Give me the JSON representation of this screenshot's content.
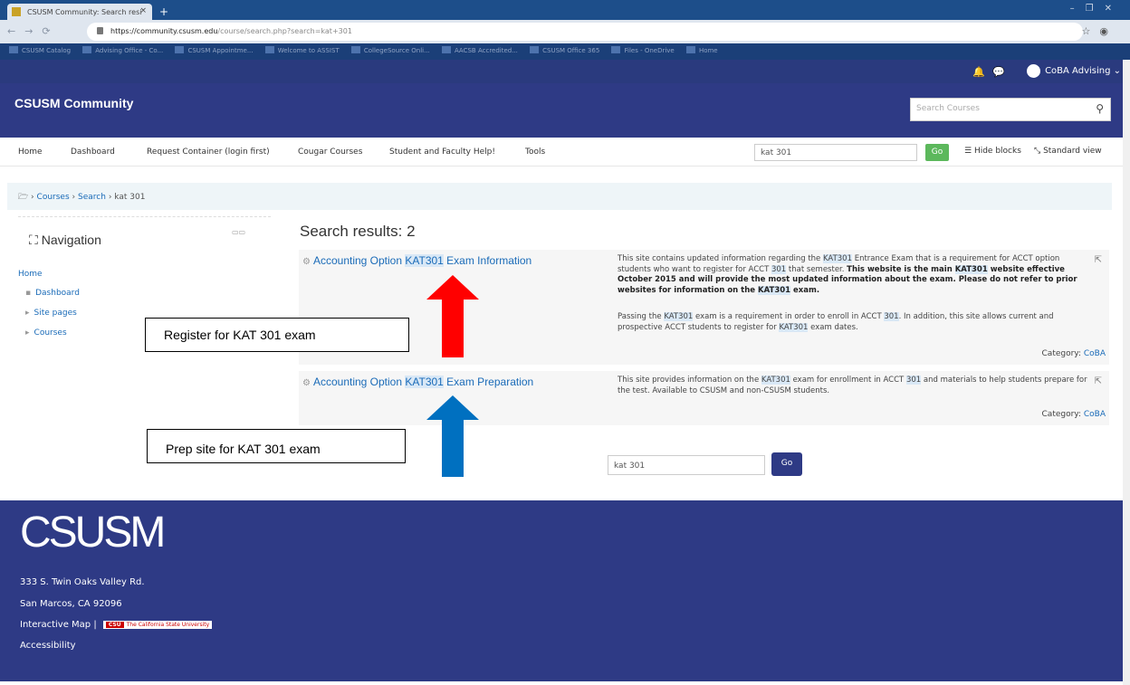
{
  "browser": {
    "tab_title": "CSUSM Community: Search resi",
    "tab_close": "×",
    "new_tab": "+",
    "url_host": "https://community.csusm.edu",
    "url_path": "/course/search.php?search=kat+301",
    "bookmarks": [
      "CSUSM Catalog",
      "Advising Office - Co...",
      "CSUSM Appointme...",
      "Welcome to ASSIST",
      "CollegeSource Onli...",
      "AACSB Accredited...",
      "CSUSM Office 365",
      "Files - OneDrive",
      "Home"
    ]
  },
  "topbar": {
    "user_name": "CoBA Advising ⌄"
  },
  "header": {
    "site_title": "CSUSM Community",
    "search_placeholder": "Search Courses"
  },
  "menu": {
    "items": [
      "Home",
      "Dashboard",
      "Request Container (login first)",
      "Cougar Courses",
      "Student and Faculty Help!",
      "Tools"
    ],
    "search_value": "kat 301",
    "go_label": "Go",
    "hide_blocks": "Hide blocks",
    "standard_view": "Standard view"
  },
  "breadcrumb": {
    "courses": "Courses",
    "search": "Search",
    "current": "kat 301",
    "sep": "›"
  },
  "navigation": {
    "title": "Navigation",
    "home": "Home",
    "items": [
      "Dashboard",
      "Site pages",
      "Courses"
    ]
  },
  "results": {
    "heading": "Search results: 2",
    "items": [
      {
        "name_pre": "Accounting Option ",
        "name_hl": "KAT301",
        "name_post": " Exam Information",
        "summary_html_1": "This site contains updated information regarding the <span class=\"hl\">KAT301</span> Entrance Exam that is a requirement for ACCT option students who want to register for ACCT <span class=\"hl\">301</span> that semester. <span class=\"bold\">This website is the main <span class=\"hl\">KAT301</span> website effective October 2015 and will provide the most updated information about the exam. Please do not refer to prior websites for information on the <span class=\"hl\">KAT301</span> exam.</span>",
        "summary_html_2": "Passing the <span class=\"hl\">KAT301</span> exam is a requirement in order to enroll in ACCT <span class=\"hl\">301</span>. In addition, this site allows current and prospective ACCT students to register for <span class=\"hl\">KAT301</span> exam dates.",
        "category_label": "Category: ",
        "category": "CoBA"
      },
      {
        "name_pre": "Accounting Option ",
        "name_hl": "KAT301",
        "name_post": " Exam Preparation",
        "summary_html_1": "This site provides information on the <span class=\"hl\">KAT301</span> exam for enrollment in ACCT <span class=\"hl\">301</span> and materials to help students prepare for the test.  Available to CSUSM and non-CSUSM students.",
        "category_label": "Category: ",
        "category": "CoBA"
      }
    ],
    "bottom_search_value": "kat 301",
    "bottom_go": "Go"
  },
  "callouts": {
    "register": "Register for KAT 301 exam",
    "prep": "Prep site for KAT 301 exam",
    "red_arrow_color": "#ff0000",
    "blue_arrow_color": "#0070c0"
  },
  "footer": {
    "logo": "CSUSM",
    "address1": "333 S. Twin Oaks Valley Rd.",
    "address2": "San Marcos, CA 92096",
    "map_link": "Interactive Map",
    "pipe": "|",
    "csu_abbr": "CSU",
    "csu_name": "The California State University",
    "accessibility": "Accessibility"
  },
  "colors": {
    "header": "#2e3a85",
    "link": "#1a6bb8",
    "go_green": "#5cb85c"
  }
}
